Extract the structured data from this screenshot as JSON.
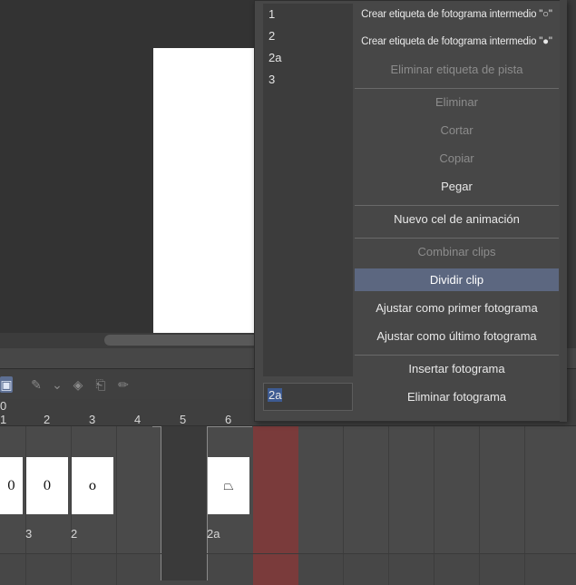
{
  "timeline": {
    "ruler_zero": "0",
    "ruler_numbers": [
      "1",
      "2",
      "3",
      "4",
      "5",
      "6"
    ],
    "cel_labels": [
      "3",
      "2",
      "2a"
    ]
  },
  "menu": {
    "name_list": [
      "1",
      "2",
      "2a",
      "3"
    ],
    "name_input_value": "2a",
    "items": {
      "create_tag_open": "Crear etiqueta de fotograma intermedio \"○\"",
      "create_tag_filled": "Crear etiqueta de fotograma intermedio \"●\"",
      "delete_track_tag": "Eliminar etiqueta de pista",
      "delete": "Eliminar",
      "cut": "Cortar",
      "copy": "Copiar",
      "paste": "Pegar",
      "new_animation_cel": "Nuevo cel de animación",
      "combine_clips": "Combinar clips",
      "split_clip": "Dividir clip",
      "set_first_frame": "Ajustar como primer fotograma",
      "set_last_frame": "Ajustar como último fotograma",
      "insert_frame": "Insertar fotograma",
      "delete_frame": "Eliminar fotograma"
    }
  },
  "colors": {
    "highlight": "#5c6780",
    "playhead": "#7a3b3b",
    "panel": "#474747"
  },
  "icons": [
    "layer-select-icon",
    "transform-icon",
    "chevron-down-icon",
    "bucket-icon",
    "cel-icon",
    "pencil-icon"
  ]
}
